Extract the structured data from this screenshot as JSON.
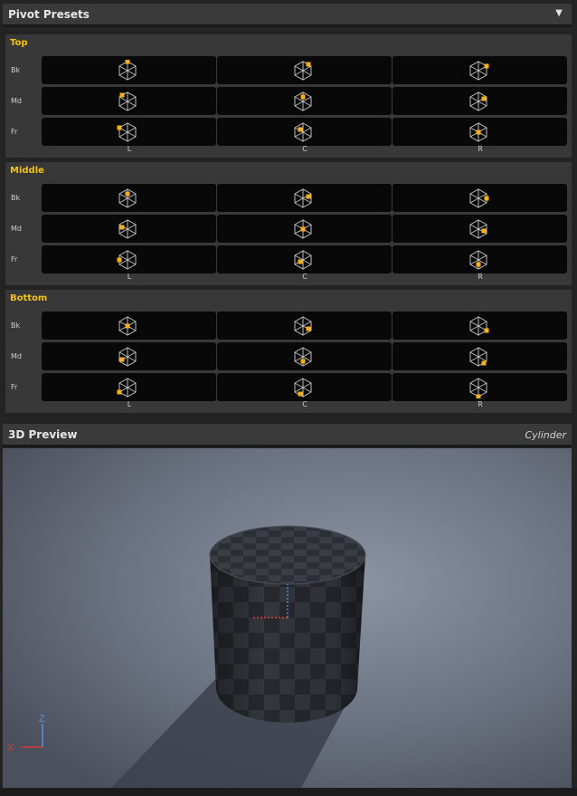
{
  "pivot_presets": {
    "title": "Pivot Presets",
    "collapse_icon": "triangle-down-icon",
    "collapse_glyph": "▼",
    "sections": [
      {
        "name": "Top",
        "level": "top"
      },
      {
        "name": "Middle",
        "level": "middle"
      },
      {
        "name": "Bottom",
        "level": "bottom"
      }
    ],
    "rows": [
      "Bk",
      "Md",
      "Fr"
    ],
    "columns": [
      "L",
      "C",
      "R"
    ],
    "button_icon": "pivot-cube-icon",
    "accent_color": "#f7b01a",
    "section_title_color": "#f2c21b"
  },
  "preview": {
    "title": "3D Preview",
    "mesh_name": "Cylinder",
    "axis_labels": {
      "x": "X",
      "z": "Z"
    },
    "axis_colors": {
      "x": "#d23b3b",
      "z": "#3b82d6"
    }
  }
}
